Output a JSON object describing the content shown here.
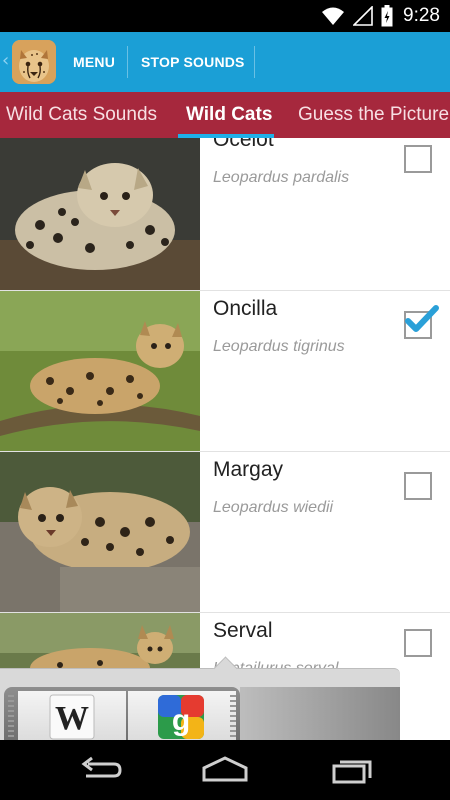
{
  "status_bar": {
    "time": "9:28",
    "icons": [
      "wifi-icon",
      "signal-icon",
      "battery-icon"
    ]
  },
  "action_bar": {
    "app_icon": "cheetah-app-icon",
    "menu_label": "MENU",
    "stop_label": "STOP SOUNDS",
    "background": "#1b9fd6"
  },
  "tabs": {
    "items": [
      {
        "label": "Wild Cats Sounds"
      },
      {
        "label": "Wild Cats"
      },
      {
        "label": "Guess the Picture"
      }
    ],
    "active": "Wild Cats",
    "background": "#a6283d",
    "indicator_color": "#1fb0e8"
  },
  "cats": [
    {
      "name": "Ocelot",
      "latin": "Leopardus pardalis",
      "checked": false
    },
    {
      "name": "Oncilla",
      "latin": "Leopardus tigrinus",
      "checked": true
    },
    {
      "name": "Margay",
      "latin": "Leopardus wiedii",
      "checked": false
    },
    {
      "name": "Serval",
      "latin": "Leptailurus serval",
      "checked": false
    }
  ],
  "drawer": {
    "items": [
      {
        "icon": "wikipedia-icon",
        "label": "W"
      },
      {
        "icon": "google-icon",
        "label": "g"
      }
    ]
  },
  "nav_bar": {
    "icons": [
      "back-icon",
      "home-icon",
      "recents-icon"
    ]
  }
}
